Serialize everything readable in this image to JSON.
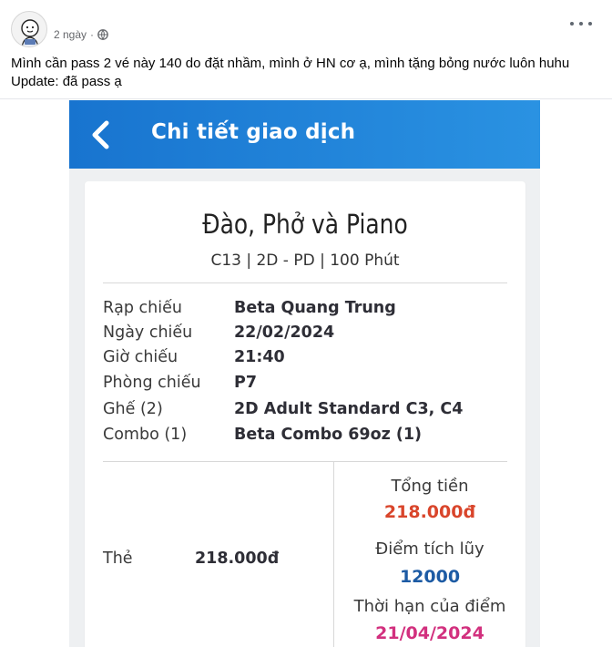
{
  "post": {
    "time": "2 ngày",
    "dot": "·",
    "caption_line1": "Mình cần pass 2 vé này 140 do đặt nhầm, mình ở HN cơ ạ, mình tặng bỏng nước luôn huhu",
    "caption_line2": "Update: đã pass ạ"
  },
  "app": {
    "title": "Chi tiết giao dịch",
    "movie_title": "Đào, Phở và Piano",
    "movie_sub": "C13 | 2D - PD | 100 Phút",
    "details": [
      {
        "label": "Rạp chiếu",
        "value": "Beta Quang Trung"
      },
      {
        "label": "Ngày chiếu",
        "value": "22/02/2024"
      },
      {
        "label": "Giờ chiếu",
        "value": "21:40"
      },
      {
        "label": "Phòng chiếu",
        "value": "P7"
      },
      {
        "label": "Ghế (2)",
        "value": "2D Adult Standard C3, C4"
      },
      {
        "label": "Combo (1)",
        "value": "Beta Combo 69oz (1)"
      }
    ],
    "payment": {
      "method": "Thẻ",
      "amount": "218.000đ"
    },
    "summary": {
      "total_label": "Tổng tiền",
      "total_value": "218.000đ",
      "points_label": "Điểm tích lũy",
      "points_value": "12000",
      "expiry_label": "Thời hạn của điểm",
      "expiry_value": "21/04/2024"
    }
  },
  "colors": {
    "appbar": "#1f82d8",
    "total": "#d9452b",
    "points": "#1d5ba4",
    "expiry": "#d2307e"
  },
  "icons": {
    "audience": "globe-icon",
    "more": "more-options-icon",
    "back": "back-arrow-icon"
  }
}
